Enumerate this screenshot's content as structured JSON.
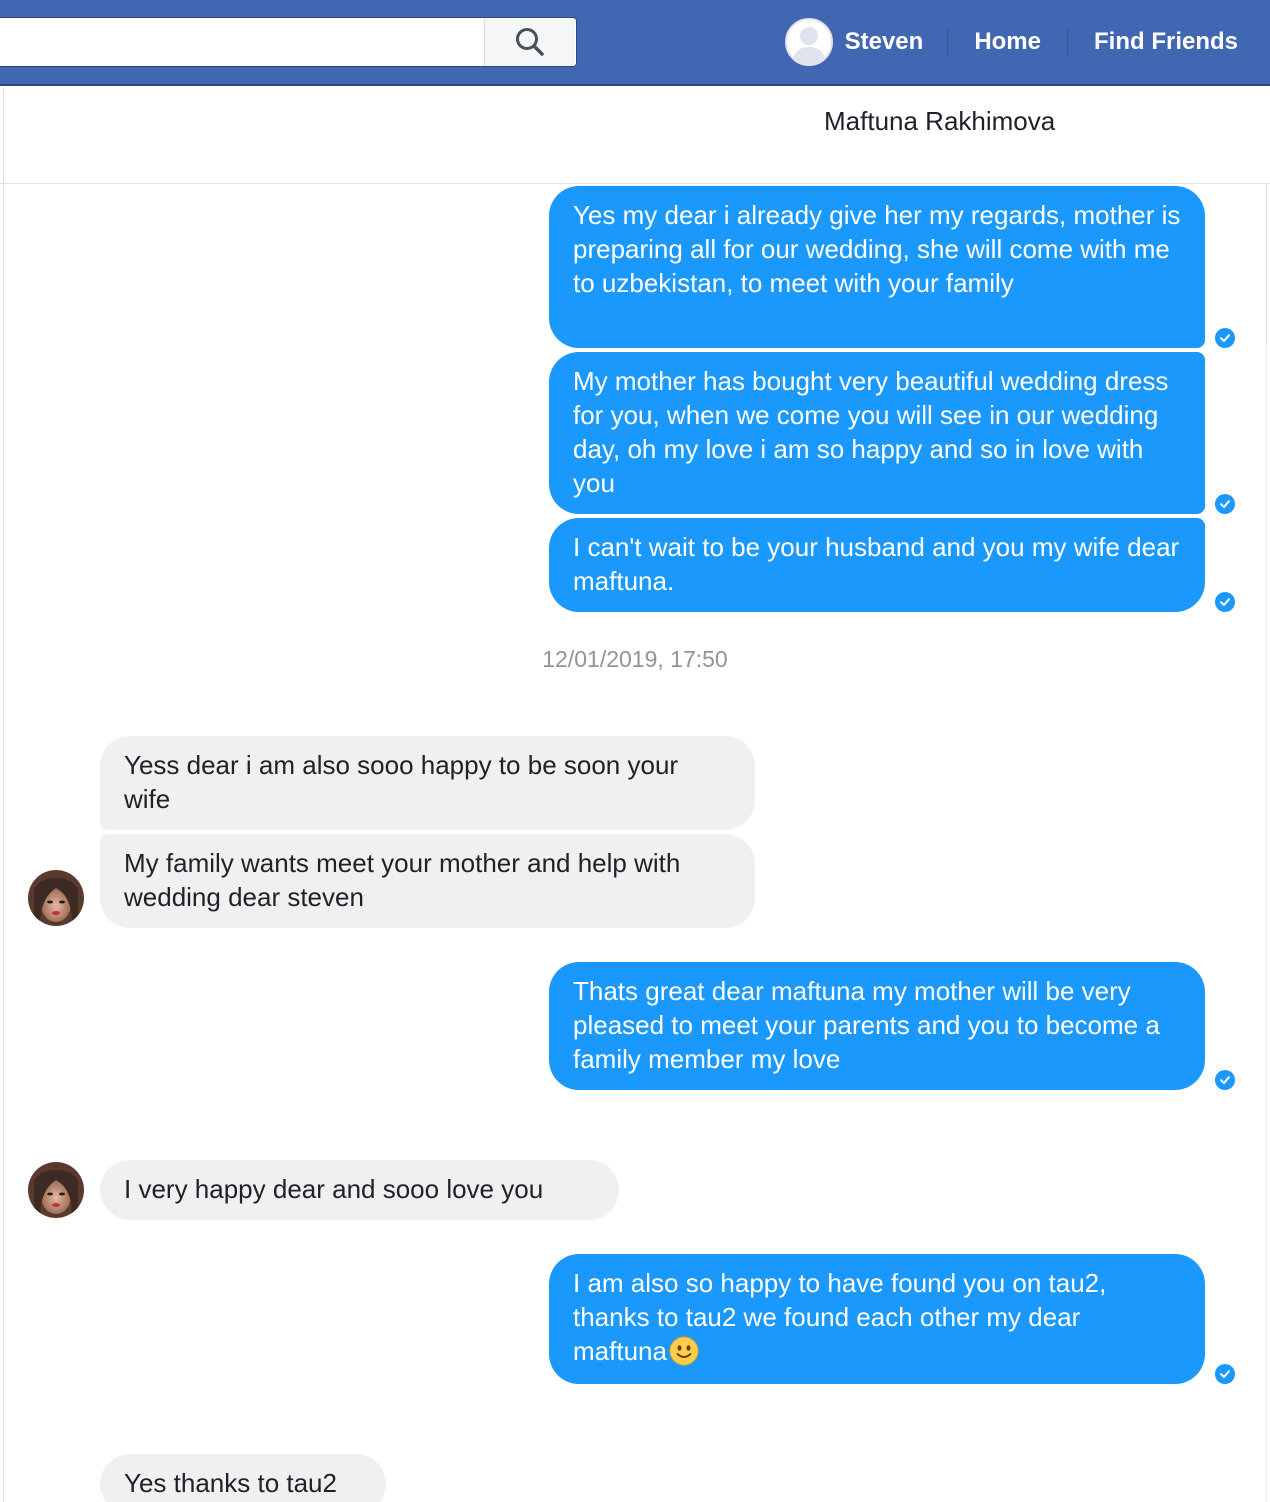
{
  "header": {
    "search": {
      "value": "",
      "placeholder": ""
    },
    "nav": {
      "profile_name": "Steven",
      "home": "Home",
      "find_friends": "Find Friends"
    }
  },
  "chat": {
    "title": "Maftuna Rakhimova",
    "timestamp": "12/01/2019, 17:50",
    "messages": [
      {
        "from": "me",
        "text": "Yes my dear i already give her my regards, mother is preparing all for our wedding, she will come with me to uzbekistan, to meet with your family",
        "status": "seen"
      },
      {
        "from": "me",
        "text": "My mother has bought very beautiful wedding dress for you, when we come you will see in our wedding day, oh my love i am so happy and so in love with you",
        "status": "seen"
      },
      {
        "from": "me",
        "text": "I can't wait to be your husband and you my wife dear maftuna.",
        "status": "seen"
      },
      {
        "from": "friend",
        "text": "Yess dear i am also sooo happy to be soon your wife"
      },
      {
        "from": "friend",
        "text": "My family wants meet your mother and help with wedding dear steven"
      },
      {
        "from": "me",
        "text": "Thats great dear maftuna my mother will be very pleased to meet your parents and you to become a family member my love",
        "status": "seen"
      },
      {
        "from": "friend",
        "text": "I very happy dear and sooo love you"
      },
      {
        "from": "me",
        "text": "I am also so happy to have found you on tau2, thanks to tau2 we found each other my dear maftuna",
        "emoji": "slightly-smiling-face",
        "status": "seen"
      },
      {
        "from": "friend",
        "text": "Yes thanks to tau2"
      }
    ]
  },
  "colors": {
    "topbar": "#4267b2",
    "outgoing_bubble": "#1a98fc",
    "incoming_bubble": "#f1f0f0"
  }
}
